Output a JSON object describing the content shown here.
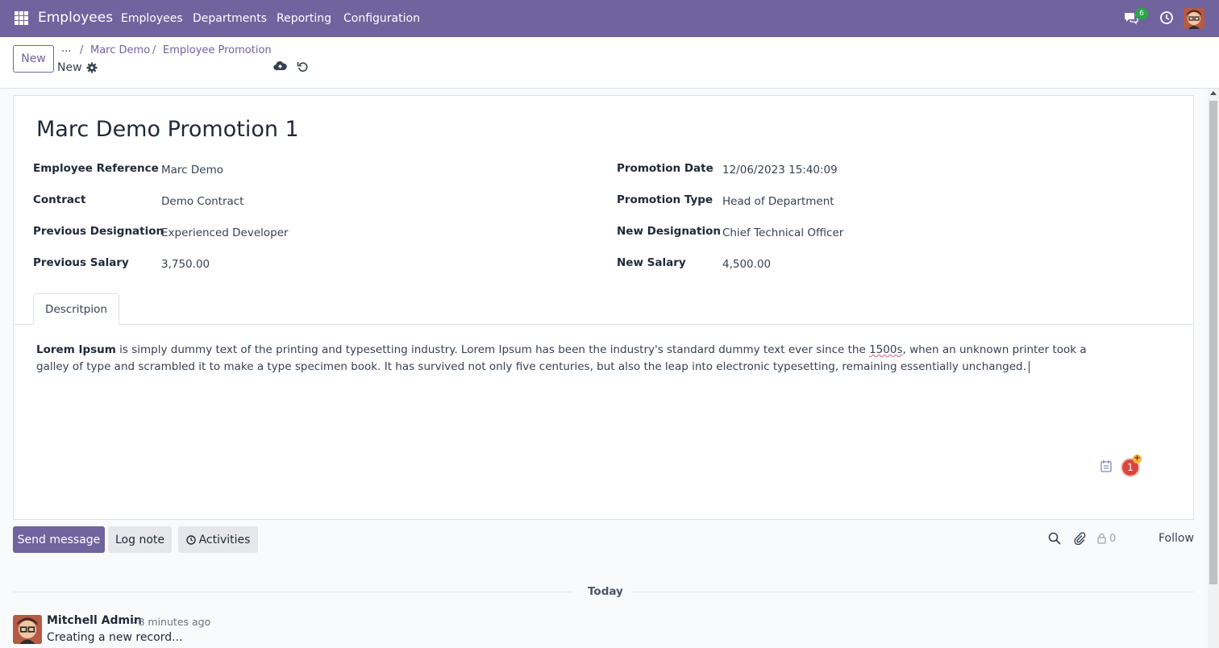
{
  "nav": {
    "app_name": "Employees",
    "menus": [
      "Employees",
      "Departments",
      "Reporting",
      "Configuration"
    ],
    "messages_badge": "6",
    "color": "#71639e"
  },
  "control": {
    "new_label": "New",
    "breadcrumb_more": "...",
    "breadcrumbs": [
      "Marc Demo",
      "Employee Promotion"
    ],
    "record_status": "New"
  },
  "form": {
    "title": "Marc Demo Promotion 1",
    "left": [
      {
        "label": "Employee Reference",
        "value": "Marc Demo"
      },
      {
        "label": "Contract",
        "value": "Demo Contract"
      },
      {
        "label": "Previous Designation",
        "value": "Experienced Developer"
      },
      {
        "label": "Previous Salary",
        "value": "3,750.00"
      }
    ],
    "right": [
      {
        "label": "Promotion Date",
        "value": "12/06/2023 15:40:09"
      },
      {
        "label": "Promotion Type",
        "value": "Head of Department"
      },
      {
        "label": "New Designation",
        "value": "Chief Technical Officer"
      },
      {
        "label": "New Salary",
        "value": "4,500.00"
      }
    ],
    "tab_label": "Descritpion",
    "description": {
      "bold": "Lorem Ipsum",
      "part1": " is simply dummy text of the printing and typesetting industry. Lorem Ipsum has been the industry's standard dummy text ever since the ",
      "flagged": "1500s",
      "part2": ", when an unknown printer took a galley of type and scrambled it to make a type specimen book. It has survived not only five centuries, but also the leap into electronic typesetting, remaining essentially unchanged."
    },
    "grammar_count": "1",
    "grammar_plus": "+"
  },
  "chatter": {
    "send_message": "Send message",
    "log_note": "Log note",
    "activities": "Activities",
    "followers_count": "0",
    "follow": "Follow",
    "date_separator": "Today",
    "message": {
      "author": "Mitchell Admin",
      "time": "- 8 minutes ago",
      "body": "Creating a new record..."
    }
  }
}
